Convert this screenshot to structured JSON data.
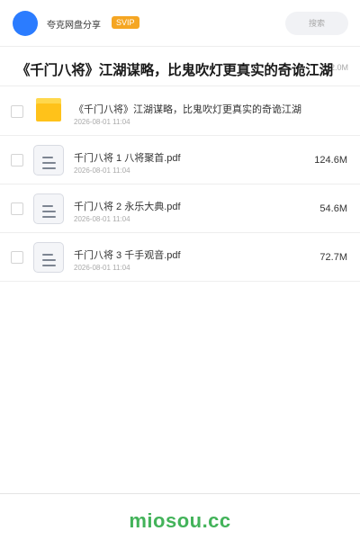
{
  "header": {
    "user_name": "夸克网盘分享",
    "badge": "SVIP",
    "search_placeholder": "搜索"
  },
  "share": {
    "title": "《千门八将》江湖谋略，比鬼吹灯更真实的奇诡江湖",
    "total_size": "252.0M"
  },
  "files": [
    {
      "type": "folder",
      "name": "《千门八将》江湖谋略，比鬼吹灯更真实的奇诡江湖",
      "date": "2026-08-01 11:04",
      "size": ""
    },
    {
      "type": "pdf",
      "name": "千门八将 1 八将聚首.pdf",
      "date": "2026-08-01 11:04",
      "size": "124.6M"
    },
    {
      "type": "pdf",
      "name": "千门八将 2 永乐大典.pdf",
      "date": "2026-08-01 11:04",
      "size": "54.6M"
    },
    {
      "type": "pdf",
      "name": "千门八将 3 千手观音.pdf",
      "date": "2026-08-01 11:04",
      "size": "72.7M"
    }
  ],
  "footer": {
    "brand": "miosou.cc"
  },
  "colors": {
    "avatar": "#2b7cff",
    "badge": "#f5a623",
    "folder": "#ffc21a",
    "brand": "#43b35a"
  },
  "icons": {
    "folder": "folder-icon",
    "pdf": "document-icon"
  }
}
